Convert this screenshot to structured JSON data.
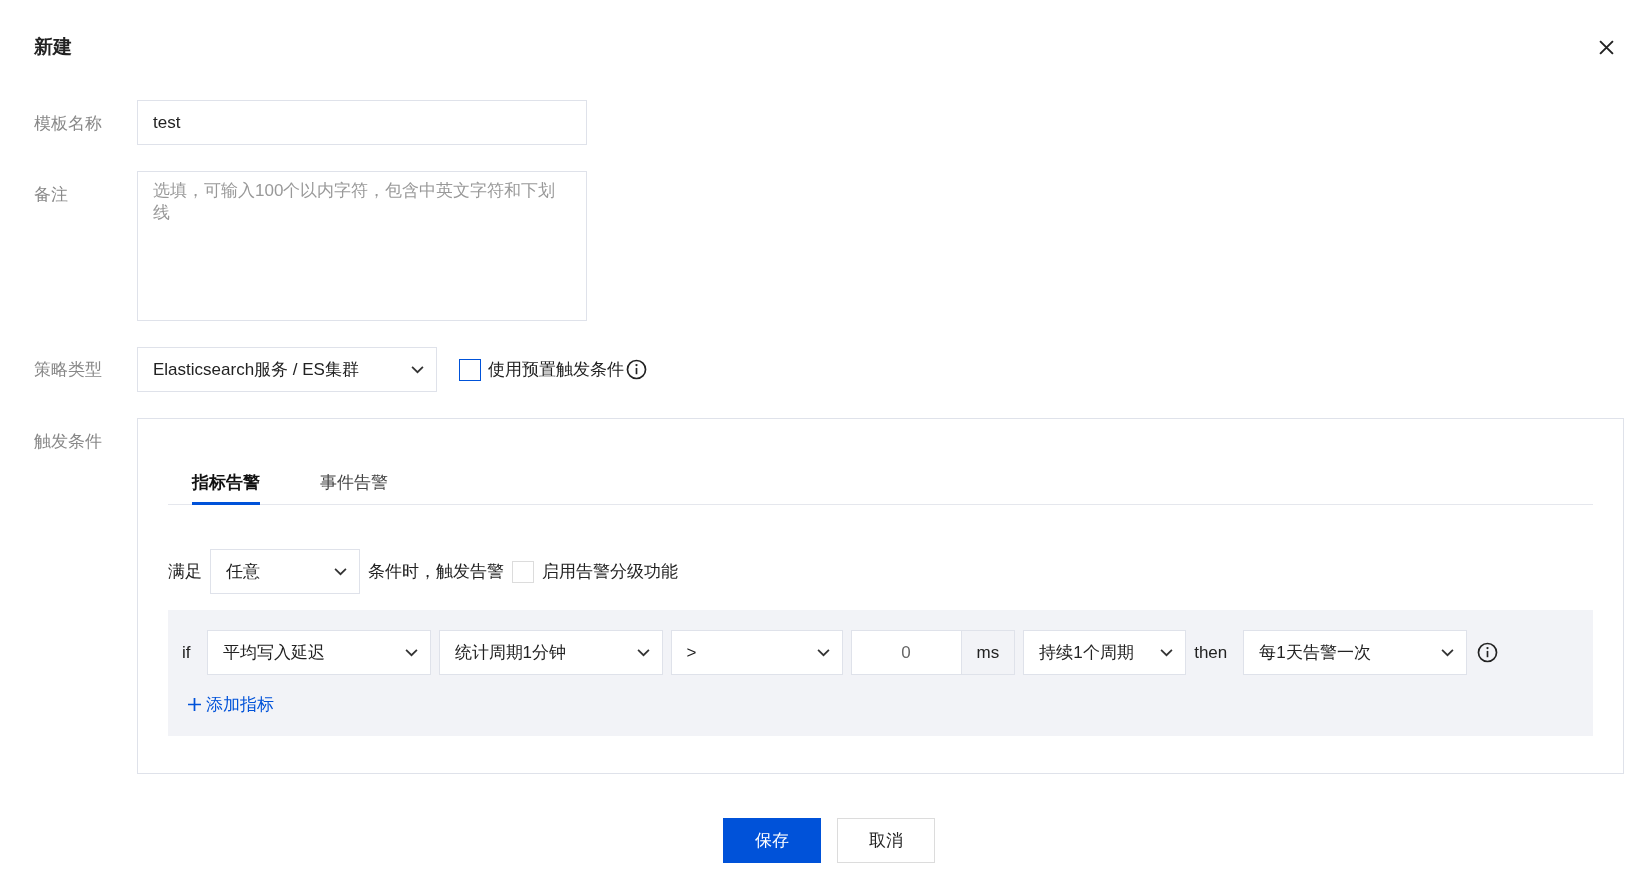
{
  "dialog": {
    "title": "新建"
  },
  "template_name": {
    "label": "模板名称",
    "value": "test"
  },
  "remark": {
    "label": "备注",
    "placeholder": "选填，可输入100个以内字符，包含中英文字符和下划线"
  },
  "policy_type": {
    "label": "策略类型",
    "value": "Elasticsearch服务 / ES集群",
    "preset": {
      "label": "使用预置触发条件",
      "checked": false
    }
  },
  "trigger": {
    "label": "触发条件",
    "tabs": [
      {
        "label": "指标告警",
        "selected": true
      },
      {
        "label": "事件告警",
        "selected": false
      }
    ],
    "match": {
      "prefix": "满足",
      "value": "任意",
      "suffix": "条件时，触发告警"
    },
    "grading": {
      "label": "启用告警分级功能",
      "checked": false
    },
    "rules": [
      {
        "if_label": "if",
        "metric": "平均写入延迟",
        "period": "统计周期1分钟",
        "operator": ">",
        "threshold": "0",
        "unit": "ms",
        "duration": "持续1个周期",
        "then_label": "then",
        "frequency": "每1天告警一次"
      }
    ],
    "add_metric": "添加指标"
  },
  "buttons": [
    {
      "label": "保存",
      "kind": "primary"
    },
    {
      "label": "取消",
      "kind": "default"
    }
  ]
}
